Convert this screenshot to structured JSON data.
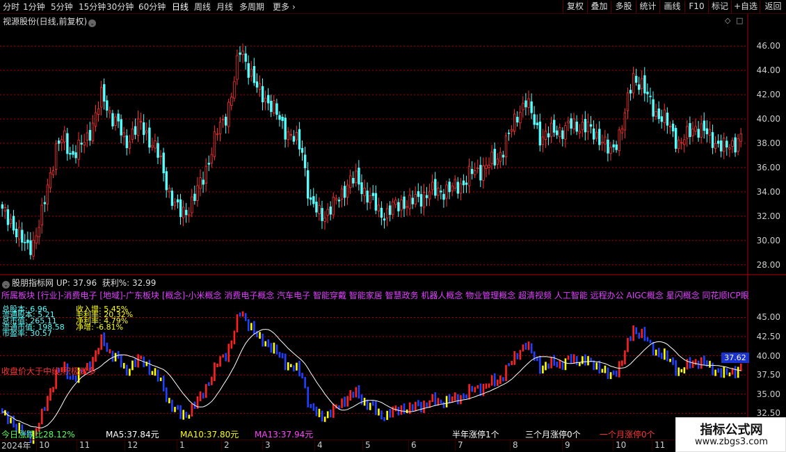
{
  "toolbar": {
    "periods": [
      "分时",
      "1分钟",
      "5分钟",
      "15分钟",
      "30分钟",
      "60分钟",
      "日线",
      "周线",
      "月线",
      "多周期",
      "更多"
    ],
    "active_period": "日线",
    "more_arrow": "›",
    "right_buttons": [
      "复权",
      "叠加",
      "多股",
      "统计",
      "画线",
      "F10",
      "标记",
      "+自选",
      "返回"
    ]
  },
  "main_chart": {
    "title": "视源股份(日线,前复权)",
    "title_toggle": "⌄",
    "corner_icons": [
      "◇",
      "□"
    ],
    "y_labels": [
      "46.00",
      "44.00",
      "42.00",
      "40.00",
      "38.00",
      "36.00",
      "34.00",
      "32.00",
      "30.00",
      "28.00"
    ]
  },
  "indicator": {
    "name": "股朋指标网",
    "toggle": "⌄",
    "up_label": "UP: 37.96",
    "profit_label": "获利%: 32.99",
    "concepts": "所属板块 [行业]-消费电子 [地域]-广东板块 [概念]-小米概念 消费电子概念 汽车电子 智能穿戴 智能家居 智慧政务 机器人概念 物业管理概念 超清视频 人工智能 远程办公 AIGC概念 星闪概念 同花顺ICP眼镜 Dee",
    "fin_left": [
      "总股本: 6.96",
      "流通股本: 5.21",
      "总市值: 265.11",
      "流通市值: 198.58",
      "市盈率: 30.57"
    ],
    "fin_right": [
      "收入增: 5.45%",
      "毛利率: 20.32%",
      "净利率: 4.79%",
      "净增: -6.81%"
    ],
    "close_note": "收盘价大于中线,积极做多",
    "price_tag": "37.62",
    "y_labels": [
      "45.00",
      "42.50",
      "40.00",
      "37.50",
      "35.00",
      "32.50"
    ]
  },
  "bottom_bar": {
    "today_ratio": "今日涨跌比28.12%",
    "ma5": "MA5:37.84元",
    "ma10": "MA10:37.80元",
    "ma13": "MA13:37.94元",
    "limit_half_year": "半年涨停1个",
    "limit_three_months": "三个月涨停0个",
    "limit_one_month": "一个月涨停0个"
  },
  "date_axis": {
    "year": "2024年",
    "months": [
      "10",
      "11",
      "12",
      "1",
      "2",
      "3",
      "4",
      "5",
      "6",
      "7",
      "8",
      "9",
      "10",
      "11"
    ]
  },
  "watermark": {
    "title": "指标公式网",
    "url": "www.zbgs3.com"
  },
  "colors": {
    "up_candle": "#ff3232",
    "down_candle": "#54ffff",
    "indicator_up": "#ffff00",
    "indicator_down": "#2040ff",
    "indicator_strong": "#ff2020",
    "mid_line": "#ffffff",
    "concepts": "#e040ff",
    "fin_left": "#55ffff",
    "fin_right": "#ffff00",
    "grid": "#b40000",
    "today_ratio": "#55ff55",
    "ma5": "#ffffff",
    "ma10": "#ffff00",
    "ma13": "#ff44ff",
    "limit_text": "#ffffff",
    "limit_month": "#ff3333"
  },
  "chart_data": [
    {
      "type": "candlestick",
      "title": "视源股份(日线,前复权)",
      "ylim": [
        27.3,
        47.5
      ],
      "y_ticks": [
        28,
        30,
        32,
        34,
        36,
        38,
        40,
        42,
        44,
        46
      ],
      "grid": true,
      "x_months": [
        "2024-09",
        "2024-10",
        "2024-11",
        "2024-12",
        "2025-01",
        "2025-02",
        "2025-03",
        "2025-04",
        "2025-05",
        "2025-06",
        "2025-07",
        "2025-08",
        "2025-09",
        "2025-10",
        "2025-11"
      ],
      "trend_close_sample": [
        32.3,
        31.8,
        30.5,
        29.5,
        29.8,
        31.5,
        35.0,
        37.5,
        38.5,
        37.0,
        37.5,
        38.5,
        40.0,
        42.0,
        40.5,
        39.5,
        38.0,
        39.0,
        39.5,
        38.5,
        37.5,
        35.5,
        33.5,
        32.2,
        32.5,
        33.5,
        35.0,
        37.0,
        39.0,
        40.2,
        42.5,
        46.0,
        44.2,
        42.5,
        42.0,
        41.0,
        40.0,
        39.0,
        38.2,
        37.5,
        33.0,
        32.3,
        32.2,
        32.8,
        33.8,
        34.8,
        35.0,
        34.2,
        33.2,
        32.4,
        32.2,
        32.8,
        33.2,
        33.0,
        33.5,
        33.8,
        34.0,
        34.2,
        34.0,
        34.5,
        34.8,
        35.5,
        35.8,
        36.2,
        36.5,
        37.5,
        38.8,
        40.5,
        41.5,
        40.0,
        38.5,
        38.7,
        39.2,
        39.0,
        39.5,
        39.5,
        39.2,
        38.8,
        38.3,
        37.0,
        38.5,
        40.5,
        43.5,
        43.0,
        41.5,
        40.5,
        40.0,
        39.0,
        38.0,
        38.5,
        39.5,
        39.0,
        38.5,
        38.0,
        37.5,
        38.0,
        38.5
      ]
    },
    {
      "type": "indicator",
      "name": "股朋指标网",
      "ylim": [
        30.9,
        47.4
      ],
      "y_ticks": [
        32.5,
        35.0,
        37.5,
        40.0,
        42.5,
        45.0
      ],
      "series": [
        {
          "name": "UP",
          "last": 37.96
        },
        {
          "name": "获利%",
          "last": 32.99
        }
      ],
      "last_price": 37.62
    }
  ]
}
